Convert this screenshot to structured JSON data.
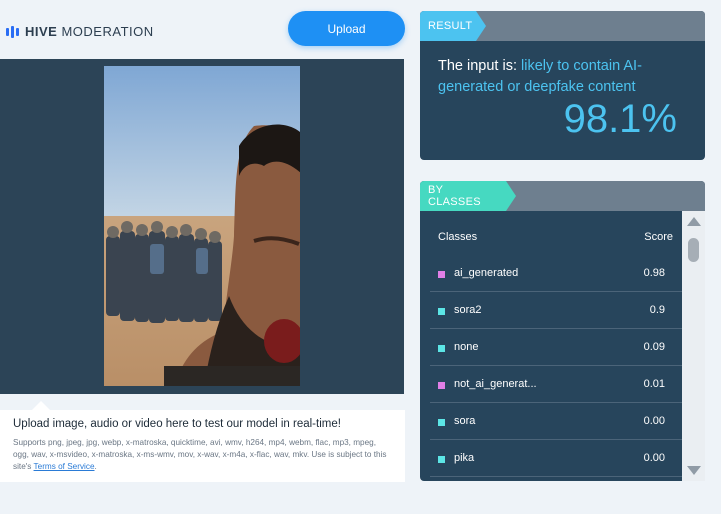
{
  "header": {
    "logo_bold": "HIVE",
    "logo_light": "MODERATION",
    "upload_label": "Upload"
  },
  "upload_info": {
    "title": "Upload image, audio or video here to test our model in real-time!",
    "supported": "Supports png, jpeg, jpg, webp, x-matroska, quicktime, avi, wmv, h264, mp4, webm, flac, mp3, mpeg, ogg, wav, x-msvideo, x-matroska, x-ms-wmv, mov, x-wav, x-m4a, x-flac, wav, mkv. Use is subject to this site's",
    "terms_link": "Terms of Service",
    "terms_suffix": "."
  },
  "result": {
    "tag": "RESULT",
    "prefix": "The input is: ",
    "verdict": "likely to contain AI-generated or deepfake content",
    "score": "98.1%"
  },
  "classes": {
    "tag": "BY CLASSES",
    "col_name": "Classes",
    "col_score": "Score",
    "rows": [
      {
        "name": "ai_generated",
        "score": "0.98",
        "color": "#e07fe6"
      },
      {
        "name": "sora2",
        "score": "0.9",
        "color": "#5ce6e6"
      },
      {
        "name": "none",
        "score": "0.09",
        "color": "#5ce6e6"
      },
      {
        "name": "not_ai_generat...",
        "score": "0.01",
        "color": "#e07fe6"
      },
      {
        "name": "sora",
        "score": "0.00",
        "color": "#5ce6e6"
      },
      {
        "name": "pika",
        "score": "0.00",
        "color": "#5ce6e6"
      }
    ]
  },
  "colors": {
    "accent": "#4cc3f0",
    "classes_tag": "#46d9c1",
    "panel": "#27455c",
    "button": "#1e90f4"
  }
}
